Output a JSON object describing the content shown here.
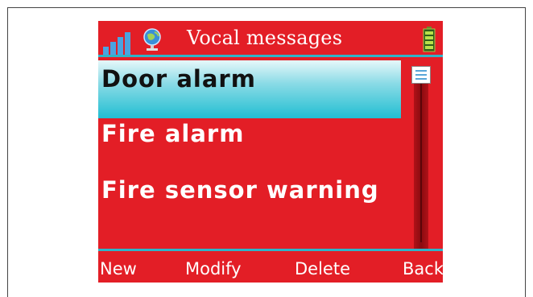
{
  "header": {
    "title": "Vocal messages",
    "icons": [
      "signal-strength-icon",
      "globe-network-icon",
      "battery-icon"
    ]
  },
  "list": {
    "items": [
      {
        "label": "Door alarm",
        "selected": true
      },
      {
        "label": "Fire alarm",
        "selected": false
      },
      {
        "label": "Fire sensor warning",
        "selected": false
      }
    ]
  },
  "softkeys": {
    "new": "New",
    "modify": "Modify",
    "delete": "Delete",
    "back": "Back"
  },
  "colors": {
    "background": "#e31e26",
    "accent": "#2fb3c8",
    "selection": "#21bed2",
    "text": "#ffffff"
  }
}
